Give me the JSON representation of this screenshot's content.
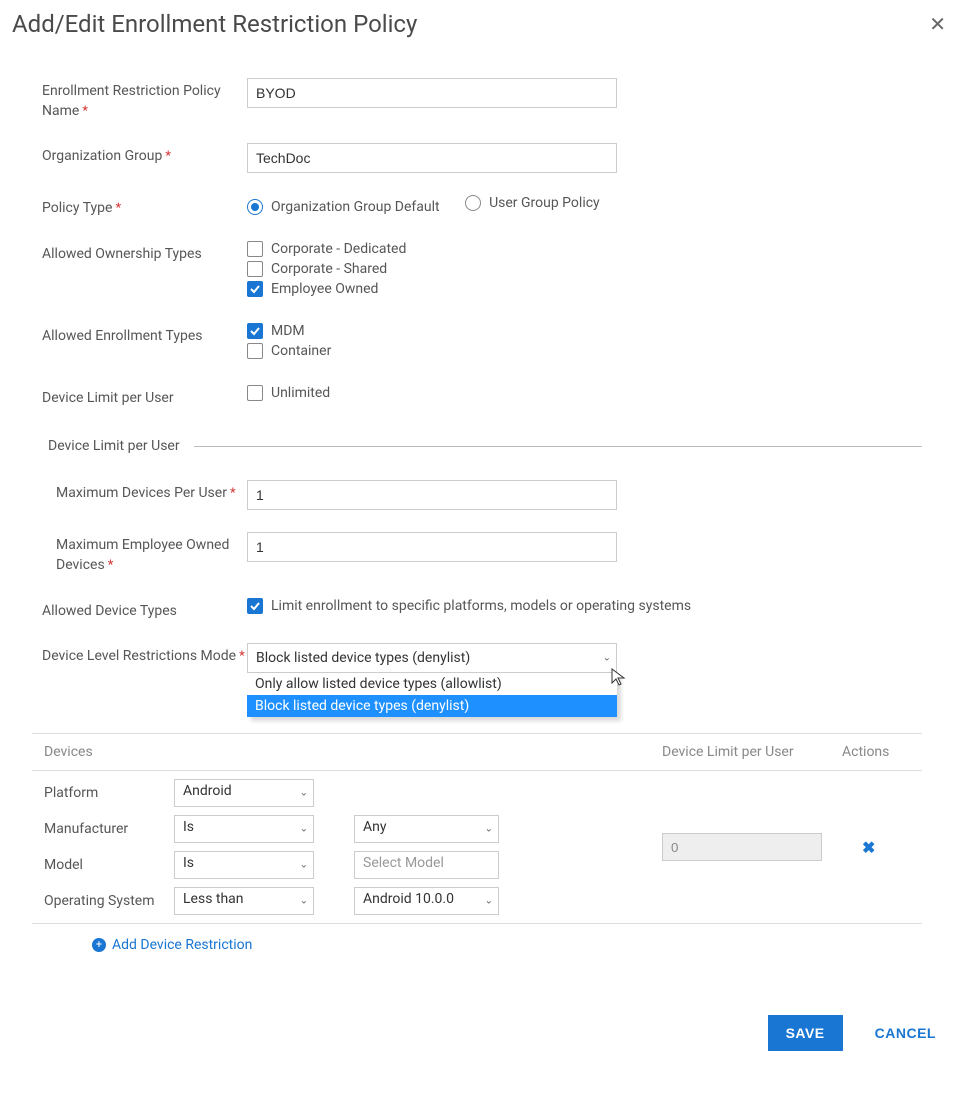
{
  "modal": {
    "title": "Add/Edit Enrollment Restriction Policy"
  },
  "fields": {
    "policy_name": {
      "label": "Enrollment Restriction Policy Name",
      "value": "BYOD"
    },
    "org_group": {
      "label": "Organization Group",
      "value": "TechDoc"
    },
    "policy_type": {
      "label": "Policy Type",
      "option1": "Organization Group Default",
      "option2": "User Group Policy"
    },
    "ownership": {
      "label": "Allowed Ownership Types",
      "opt1": "Corporate - Dedicated",
      "opt2": "Corporate - Shared",
      "opt3": "Employee Owned"
    },
    "enrollment": {
      "label": "Allowed Enrollment Types",
      "opt1": "MDM",
      "opt2": "Container"
    },
    "device_limit_cb": {
      "label": "Device Limit per User",
      "opt": "Unlimited"
    },
    "section_title": "Device Limit per User",
    "max_devices": {
      "label": "Maximum Devices Per User",
      "value": "1"
    },
    "max_emp_owned": {
      "label": "Maximum Employee Owned Devices",
      "value": "1"
    },
    "allowed_device_types": {
      "label": "Allowed Device Types",
      "opt": "Limit enrollment to specific platforms, models or operating systems"
    },
    "restrictions_mode": {
      "label": "Device Level Restrictions Mode",
      "selected": "Block listed device types (denylist)",
      "option_allow": "Only allow listed device types (allowlist)",
      "option_block": "Block listed device types (denylist)"
    }
  },
  "devices_table": {
    "header": {
      "devices": "Devices",
      "limit": "Device Limit per User",
      "actions": "Actions"
    },
    "row": {
      "platform_label": "Platform",
      "platform_value": "Android",
      "manufacturer_label": "Manufacturer",
      "manufacturer_op": "Is",
      "manufacturer_value": "Any",
      "model_label": "Model",
      "model_op": "Is",
      "model_placeholder": "Select Model",
      "os_label": "Operating System",
      "os_op": "Less than",
      "os_value": "Android 10.0.0",
      "limit_value": "0"
    },
    "add_link": "Add Device Restriction"
  },
  "footer": {
    "save": "SAVE",
    "cancel": "CANCEL"
  }
}
